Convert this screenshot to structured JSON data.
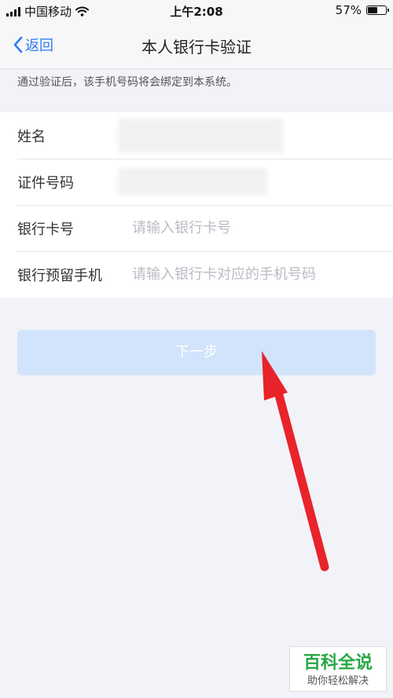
{
  "status_bar": {
    "carrier": "中国移动",
    "time": "上午2:08",
    "battery_percent": "57%",
    "battery_level": 0.57
  },
  "nav": {
    "back_label": "返回",
    "title": "本人银行卡验证"
  },
  "notice": "通过验证后，该手机号码将会绑定到本系统。",
  "form": {
    "rows": [
      {
        "label": "姓名",
        "value": ""
      },
      {
        "label": "证件号码",
        "value": ""
      },
      {
        "label": "银行卡号",
        "placeholder": "请输入银行卡号"
      },
      {
        "label": "银行预留手机",
        "placeholder": "请输入银行卡对应的手机号码"
      }
    ]
  },
  "next_button": "下一步",
  "watermark": {
    "title": "百科全说",
    "subtitle": "助你轻松解决"
  },
  "colors": {
    "accent": "#2f7cf6",
    "button_disabled": "#d2e4fb",
    "arrow": "#e8232a",
    "watermark": "#27a845"
  },
  "icons": [
    "signal-icon",
    "wifi-icon",
    "battery-icon",
    "back-chevron-icon"
  ]
}
